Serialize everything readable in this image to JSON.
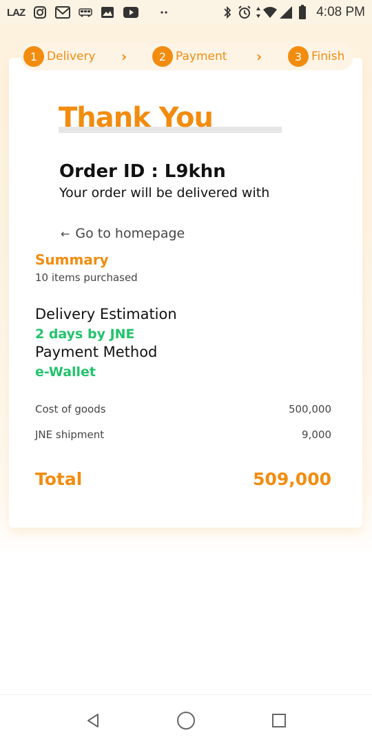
{
  "status_bar": {
    "app_label": "LAZ",
    "time": "4:08 PM",
    "icons": [
      "laz-app-icon",
      "instagram-icon",
      "gmail-icon",
      "bus-icon",
      "image-icon",
      "youtube-icon",
      "more-dots-icon",
      "bluetooth-icon",
      "alarm-icon",
      "data-arrows-icon",
      "wifi-icon",
      "signal-icon",
      "battery-icon"
    ]
  },
  "steps": [
    {
      "number": "1",
      "label": "Delivery"
    },
    {
      "number": "2",
      "label": "Payment"
    },
    {
      "number": "3",
      "label": "Finish"
    }
  ],
  "confirmation": {
    "title": "Thank You",
    "order_id": "Order ID : L9khn",
    "message": "Your order will be delivered with",
    "home_link": "Go to homepage"
  },
  "summary": {
    "title": "Summary",
    "items_text": "10 items purchased",
    "delivery_label": "Delivery Estimation",
    "delivery_value": "2 days by JNE",
    "payment_label": "Payment Method",
    "payment_value": "e-Wallet",
    "rows": [
      {
        "label": "Cost of goods",
        "value": "500,000"
      },
      {
        "label": "JNE shipment",
        "value": "9,000"
      }
    ],
    "total_label": "Total",
    "total_value": "509,000"
  },
  "colors": {
    "accent": "#f28c0f",
    "success": "#22c36c",
    "status_bar_bg": "#fbf3e3"
  },
  "nav_bar": {
    "icons": [
      "back-triangle-icon",
      "home-circle-icon",
      "recents-square-icon"
    ]
  }
}
